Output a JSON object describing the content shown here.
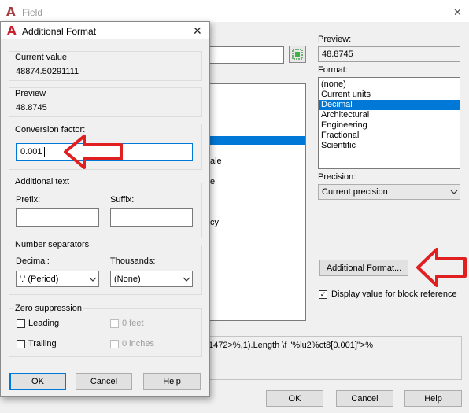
{
  "field_dialog": {
    "title": "Field",
    "close_symbol": "✕",
    "preview_label": "Preview:",
    "preview_value": "48.8745",
    "format_label": "Format:",
    "format_options": [
      "(none)",
      "Current units",
      "Decimal",
      "Architectural",
      "Engineering",
      "Fractional",
      "Scientific"
    ],
    "selected_format": "Decimal",
    "precision_label": "Precision:",
    "precision_value": "Current precision",
    "additional_format_button": "Additional Format...",
    "display_block_ref_label": "Display value for block reference",
    "display_block_ref_checked": true,
    "list_fragments": [
      "ale",
      "e",
      "cy"
    ],
    "expression_text": "1472>%,1).Length \\f \"%lu2%ct8[0.001]\">%",
    "ok_label": "OK",
    "cancel_label": "Cancel",
    "help_label": "Help"
  },
  "additional_format_dialog": {
    "title": "Additional Format",
    "close_symbol": "✕",
    "current_value_label": "Current value",
    "current_value": "48874.50291111",
    "preview_label": "Preview",
    "preview_value": "48.8745",
    "conversion_factor_label": "Conversion factor:",
    "conversion_factor_value": "0.001",
    "additional_text_label": "Additional text",
    "prefix_label": "Prefix:",
    "prefix_value": "",
    "suffix_label": "Suffix:",
    "suffix_value": "",
    "number_separators_label": "Number separators",
    "decimal_label": "Decimal:",
    "decimal_value": "'.' (Period)",
    "thousands_label": "Thousands:",
    "thousands_value": "(None)",
    "zero_suppression_label": "Zero suppression",
    "leading_label": "Leading",
    "trailing_label": "Trailing",
    "zero_feet_label": "0 feet",
    "zero_inches_label": "0 inches",
    "ok_label": "OK",
    "cancel_label": "Cancel",
    "help_label": "Help"
  },
  "annotation_color": "#e02020",
  "accent_color": "#0078d7",
  "icons": {
    "app": "autocad-logo-icon",
    "pick": "pick-object-icon",
    "arrow": "red-arrow-icon"
  }
}
